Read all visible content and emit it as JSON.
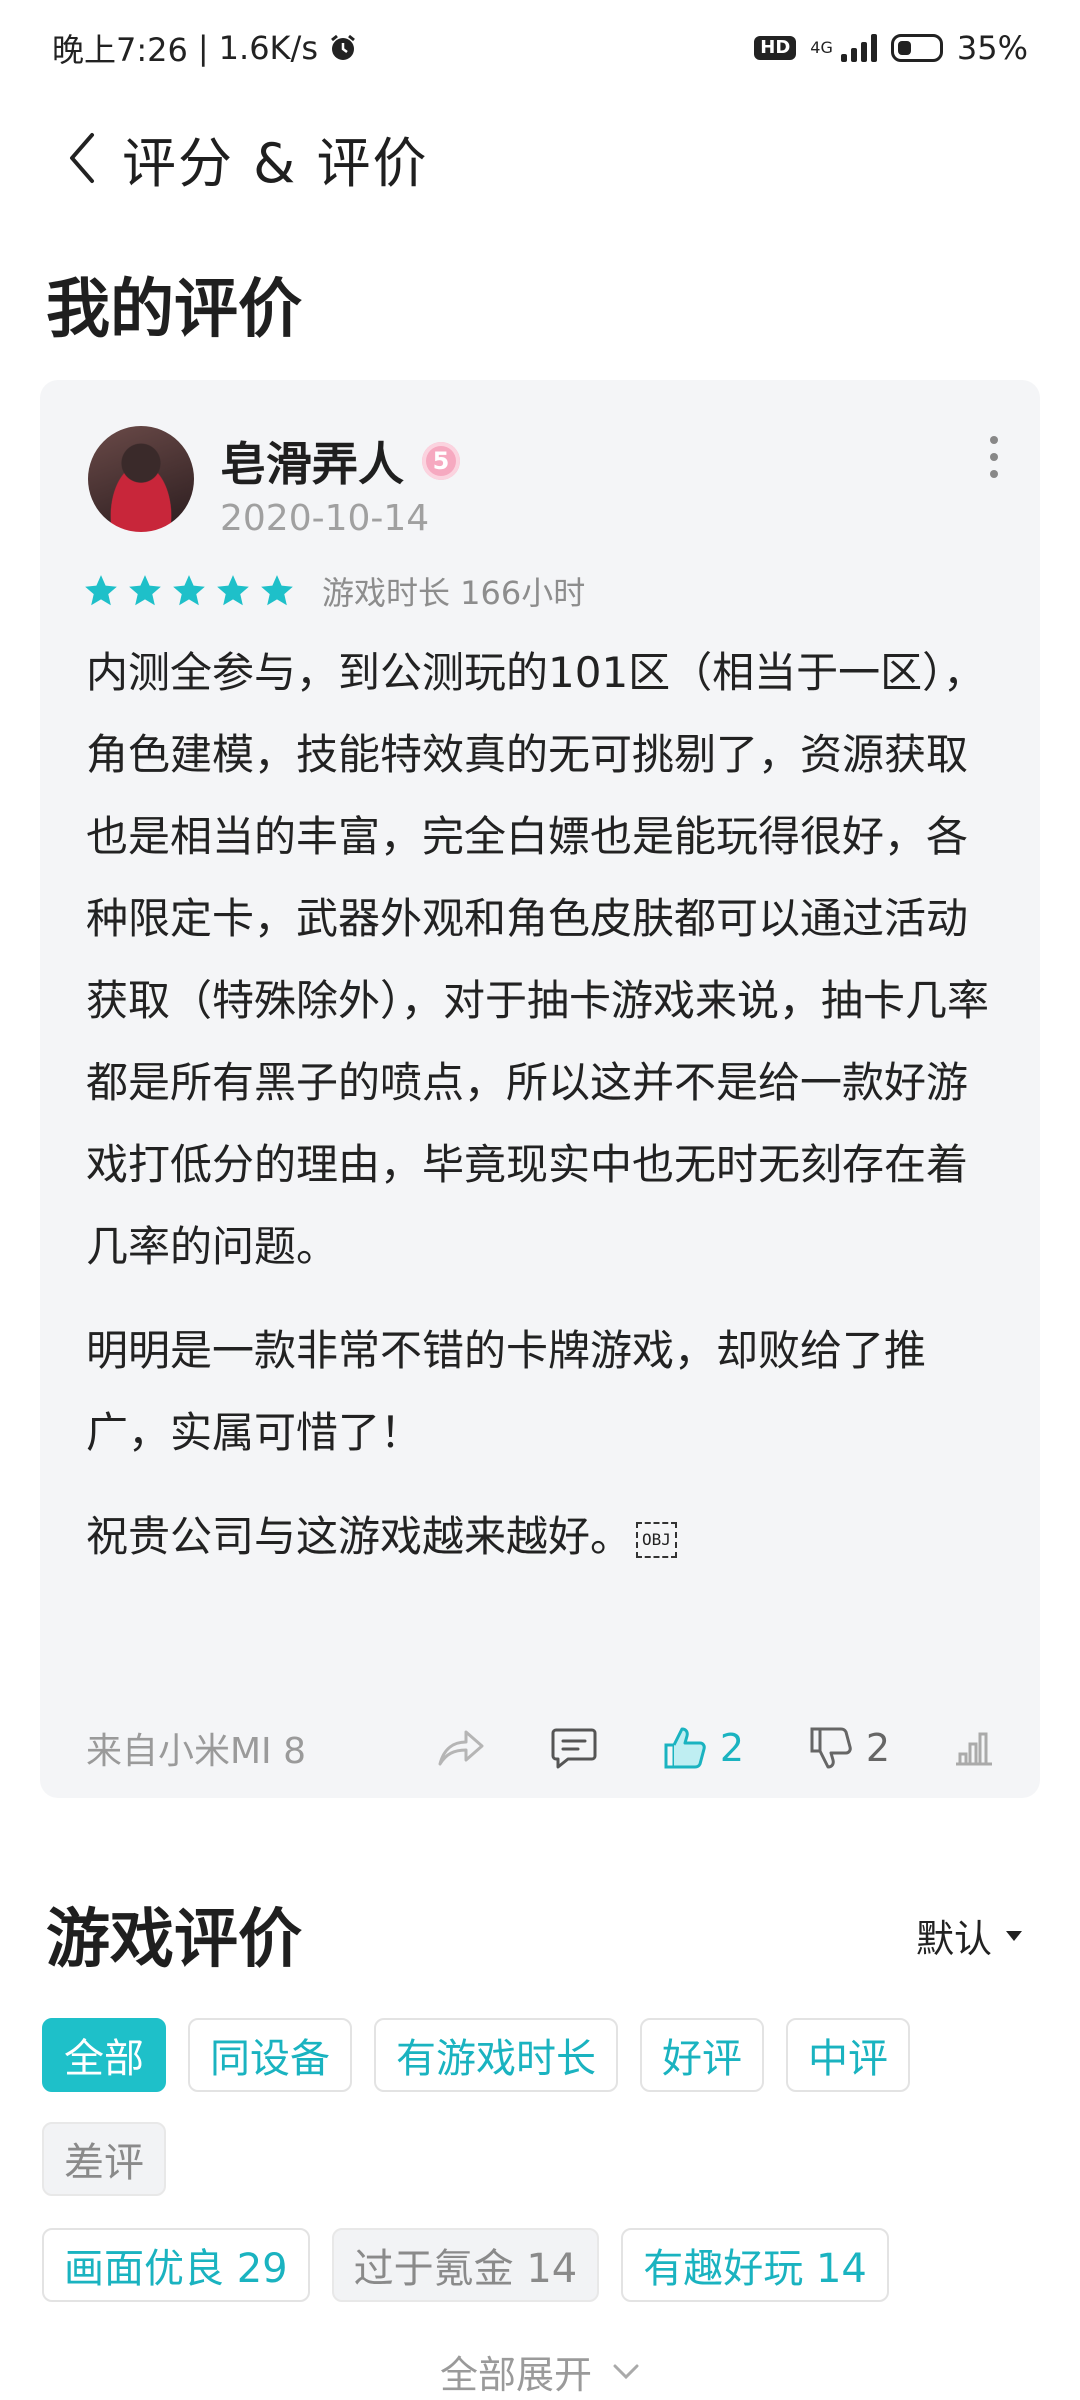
{
  "status_bar": {
    "time": "晚上7:26",
    "separator": "|",
    "net_speed": "1.6K/s",
    "hd": "HD",
    "network": "4G",
    "battery": "35%",
    "battery_level": 0.35
  },
  "header": {
    "title": "评分 & 评价"
  },
  "my_review": {
    "section_title": "我的评价",
    "user_name": "皂滑弄人",
    "level": "5",
    "date": "2020-10-14",
    "stars": 5,
    "playtime": "游戏时长 166小时",
    "paragraphs": [
      "内测全参与，到公测玩的101区（相当于一区），角色建模，技能特效真的无可挑剔了，资源获取也是相当的丰富，完全白嫖也是能玩得很好，各种限定卡，武器外观和角色皮肤都可以通过活动获取（特殊除外），对于抽卡游戏来说，抽卡几率都是所有黑子的喷点，所以这并不是给一款好游戏打低分的理由，毕竟现实中也无时无刻存在着几率的问题。",
      "明明是一款非常不错的卡牌游戏，却败给了推广，实属可惜了！",
      "祝贵公司与这游戏越来越好。"
    ],
    "obj_marker": "OBJ",
    "device": "来自小米MI 8",
    "likes": "2",
    "dislikes": "2"
  },
  "game_reviews": {
    "section_title": "游戏评价",
    "sort": "默认",
    "filters": [
      "全部",
      "同设备",
      "有游戏时长",
      "好评",
      "中评"
    ],
    "filters_row2": [
      "差评"
    ],
    "keyword_tags": [
      "画面优良 29",
      "过于氪金 14",
      "有趣好玩 14"
    ],
    "expand_all": "全部展开"
  },
  "colors": {
    "accent": "#1ec0c9",
    "card_bg": "#f4f5f7"
  }
}
